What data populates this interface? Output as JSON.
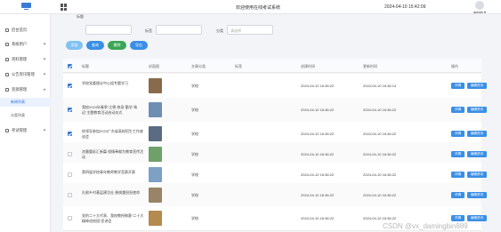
{
  "header": {
    "title": "欢迎使用在线考试系统",
    "datetime": "2024-04-10 15:42:09",
    "user": "admin"
  },
  "sidebar": {
    "items": [
      {
        "label": "后台首页",
        "icon": "home-icon"
      },
      {
        "label": "系统用户",
        "icon": "user-icon"
      },
      {
        "label": "资料管理",
        "icon": "folder-icon"
      },
      {
        "label": "公告资讯管理",
        "icon": "notice-icon"
      },
      {
        "label": "资源管理",
        "icon": "resource-icon"
      },
      {
        "label": "考试管理",
        "icon": "exam-icon"
      }
    ],
    "sub_items": [
      {
        "label": "新闻列表",
        "active": true
      },
      {
        "label": "分类列表",
        "active": false
      }
    ]
  },
  "filters": {
    "title_label": "标题",
    "title_placeholder": "",
    "tag_label": "标签",
    "tag_placeholder": "",
    "category_label": "分类",
    "category_placeholder": "请选择"
  },
  "toolbar": {
    "add": "添加",
    "search": "查询",
    "delete": "删除",
    "export": "导出"
  },
  "table": {
    "headers": [
      "标题",
      "封面图",
      "文章分类",
      "标签",
      "创建时间",
      "更新时间",
      "操作"
    ],
    "rows": [
      {
        "checked": true,
        "title": "学校党委理论中心组专题学习",
        "category": "学校",
        "tag": "",
        "created": "2024-04-10 16:36:22",
        "updated": "2024-04-10 16:36:14",
        "thumb_color": "#8a6a4c"
      },
      {
        "checked": true,
        "title": "我校2024年春季“立德·修身·勤学·致远”主题教育活动启动仪式",
        "category": "学校",
        "tag": "",
        "created": "2024-04-10 16:36:22",
        "updated": "2024-04-10 16:36:22",
        "thumb_color": "#6e8fb3"
      },
      {
        "checked": true,
        "title": "校领导参加2023广东省高校招生工作座谈会",
        "category": "学校",
        "tag": "",
        "created": "2024-04-10 16:36:22",
        "updated": "2024-04-10 16:36:22",
        "thumb_color": "#5b6b83"
      },
      {
        "checked": false,
        "title": "浓墨重彩汇新篇 倾情奉献为教育宣传活动",
        "category": "学校",
        "tag": "",
        "created": "2024-04-10 16:36:22",
        "updated": "2024-04-10 16:36:22",
        "thumb_color": "#6fa06a"
      },
      {
        "checked": false,
        "title": "第四届学校青年教师教学竞赛开赛",
        "category": "学校",
        "tag": "",
        "created": "2024-04-10 16:36:22",
        "updated": "2024-04-10 16:36:22",
        "thumb_color": "#7da0c4"
      },
      {
        "checked": false,
        "title": "扎根乡村基层建功业 勇挑重担担使命",
        "category": "学校",
        "tag": "",
        "created": "2024-04-10 16:36:22",
        "updated": "2024-04-10 16:36:22",
        "thumb_color": "#9a8467"
      },
      {
        "checked": false,
        "title": "党的二十大代表、我校教授做客“二十大精神进校园”宣讲会",
        "category": "学校",
        "tag": "",
        "created": "2024-04-10 16:36:22",
        "updated": "2024-04-10 16:36:22",
        "thumb_color": "#b48a4e"
      }
    ],
    "row_actions": {
      "detail": "详情",
      "edit": "编辑资讯"
    }
  },
  "watermark": "CSDN @vx_damingbin889",
  "colors": {
    "primary": "#3a8ee6",
    "danger": "#3aa655",
    "bg": "#f3f4f7"
  }
}
